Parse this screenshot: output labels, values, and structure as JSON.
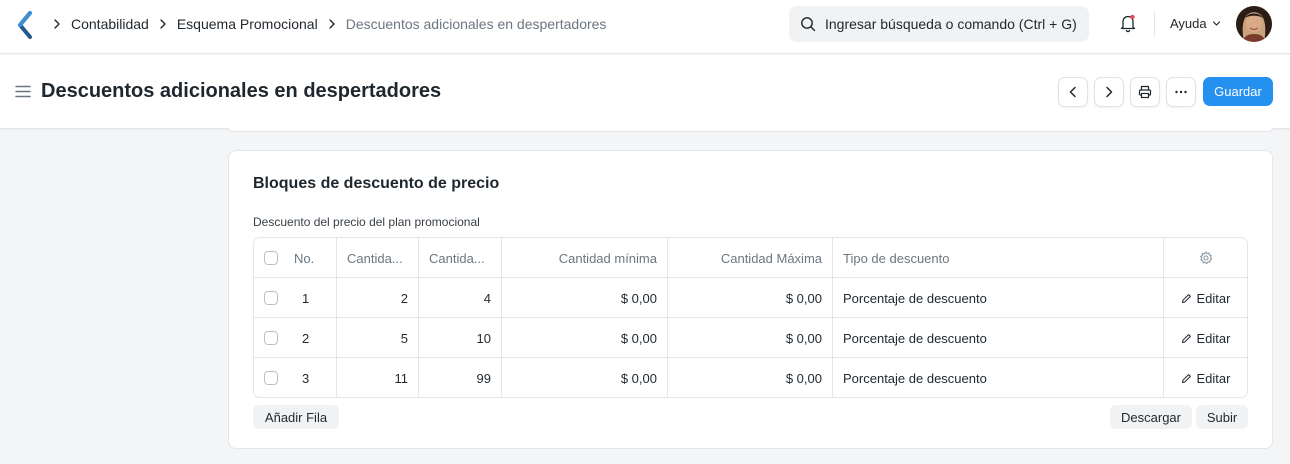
{
  "navbar": {
    "breadcrumbs": [
      "Contabilidad",
      "Esquema Promocional",
      "Descuentos adicionales en despertadores"
    ],
    "search_placeholder": "Ingresar búsqueda o comando (Ctrl + G)",
    "help_label": "Ayuda"
  },
  "page": {
    "title": "Descuentos adicionales en despertadores",
    "save_label": "Guardar"
  },
  "section": {
    "title": "Bloques de descuento de precio",
    "field_label": "Descuento del precio del plan promocional",
    "columns": [
      "No.",
      "Cantida...",
      "Cantida...",
      "Cantidad mínima",
      "Cantidad Máxima",
      "Tipo de descuento"
    ],
    "rows": [
      {
        "no": "1",
        "qty_from": "2",
        "qty_to": "4",
        "min_amount": "$ 0,00",
        "max_amount": "$ 0,00",
        "discount_type": "Porcentaje de descuento",
        "edit": "Editar"
      },
      {
        "no": "2",
        "qty_from": "5",
        "qty_to": "10",
        "min_amount": "$ 0,00",
        "max_amount": "$ 0,00",
        "discount_type": "Porcentaje de descuento",
        "edit": "Editar"
      },
      {
        "no": "3",
        "qty_from": "11",
        "qty_to": "99",
        "min_amount": "$ 0,00",
        "max_amount": "$ 0,00",
        "discount_type": "Porcentaje de descuento",
        "edit": "Editar"
      }
    ],
    "add_row_label": "Añadir Fila",
    "download_label": "Descargar",
    "upload_label": "Subir"
  },
  "colors": {
    "primary": "#2490ef",
    "logo": "#1f5a8a"
  },
  "icons": [
    "app-logo-icon",
    "search-icon",
    "bell-icon",
    "chevron-down-icon",
    "menu-icon",
    "chevron-left-icon",
    "chevron-right-icon",
    "printer-icon",
    "more-icon",
    "settings-icon",
    "pencil-icon"
  ]
}
